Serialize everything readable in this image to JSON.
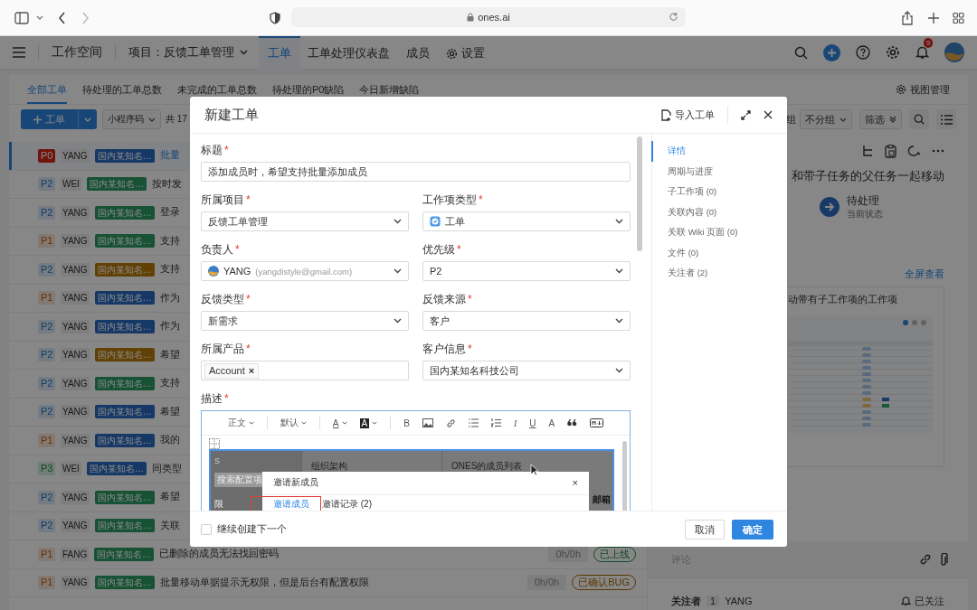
{
  "browser": {
    "url": "ones.ai"
  },
  "header": {
    "workspace": "工作空间",
    "project": "项目：反馈工单管理",
    "nav": [
      {
        "label": "工单",
        "kind": "plain",
        "selected": true
      },
      {
        "label": "工单处理仪表盘",
        "kind": "plain",
        "selected": false
      },
      {
        "label": "成员",
        "kind": "plain",
        "selected": false
      },
      {
        "label": "设置",
        "kind": "settings",
        "selected": false
      }
    ],
    "notification_count": "9"
  },
  "view_tabs": [
    {
      "label": "全部工单",
      "selected": true
    },
    {
      "label": "待处理的工单总数",
      "selected": false
    },
    {
      "label": "未完成的工单总数",
      "selected": false
    },
    {
      "label": "待处理的P0缺陷",
      "selected": false
    },
    {
      "label": "今日新增缺陷",
      "selected": false
    }
  ],
  "view_manage": "视图管理",
  "toolbar": {
    "new_button": "工单",
    "sort": "小程序码",
    "count": "共 17",
    "group_label": "组",
    "group": "不分组",
    "filter": "筛选"
  },
  "rows": [
    {
      "priority": {
        "label": "P0",
        "color": "#70150f",
        "filled": true
      },
      "assignee": "YANG",
      "customer": {
        "label": "国内某知名…",
        "color": "#163866"
      },
      "title": "批量",
      "selected": true
    },
    {
      "priority": {
        "label": "P2",
        "color": "#747b82",
        "filled": false
      },
      "assignee": "WEI",
      "customer": {
        "label": "国内某知名…",
        "color": "#185234"
      },
      "title": "按时发",
      "selected": false
    },
    {
      "priority": {
        "label": "P2",
        "color": "#747b82",
        "filled": false
      },
      "assignee": "YANG",
      "customer": {
        "label": "国内某知名…",
        "color": "#185234"
      },
      "title": "登录",
      "selected": false
    },
    {
      "priority": {
        "label": "P1",
        "color": "#827972",
        "filled": false
      },
      "assignee": "YANG",
      "customer": {
        "label": "国内某知名…",
        "color": "#185234"
      },
      "title": "支持",
      "selected": false
    },
    {
      "priority": {
        "label": "P2",
        "color": "#747b82",
        "filled": false
      },
      "assignee": "YANG",
      "customer": {
        "label": "国内某知名…",
        "color": "#624105"
      },
      "title": "支持",
      "selected": false
    },
    {
      "priority": {
        "label": "P1",
        "color": "#827972",
        "filled": false
      },
      "assignee": "YANG",
      "customer": {
        "label": "国内某知名…",
        "color": "#163866"
      },
      "title": "作为",
      "selected": false
    },
    {
      "priority": {
        "label": "P2",
        "color": "#747b82",
        "filled": false
      },
      "assignee": "YANG",
      "customer": {
        "label": "国内某知名…",
        "color": "#163866"
      },
      "title": "作为",
      "selected": false
    },
    {
      "priority": {
        "label": "P2",
        "color": "#747b82",
        "filled": false
      },
      "assignee": "YANG",
      "customer": {
        "label": "国内某知名…",
        "color": "#624105"
      },
      "title": "希望",
      "selected": false
    },
    {
      "priority": {
        "label": "P2",
        "color": "#747b82",
        "filled": false
      },
      "assignee": "YANG",
      "customer": {
        "label": "国内某知名…",
        "color": "#185234"
      },
      "title": "支持",
      "selected": false
    },
    {
      "priority": {
        "label": "P2",
        "color": "#747b82",
        "filled": false
      },
      "assignee": "YANG",
      "customer": {
        "label": "国内某知名…",
        "color": "#163866"
      },
      "title": "希望",
      "selected": false
    },
    {
      "priority": {
        "label": "P1",
        "color": "#827972",
        "filled": false
      },
      "assignee": "YANG",
      "customer": {
        "label": "国内某知名…",
        "color": "#163866"
      },
      "title": "我的",
      "selected": false
    },
    {
      "priority": {
        "label": "P3",
        "color": "#737d77",
        "filled": false
      },
      "assignee": "WEI",
      "customer": {
        "label": "国内某知名…",
        "color": "#163866"
      },
      "title": "同类型",
      "selected": false
    },
    {
      "priority": {
        "label": "P2",
        "color": "#747b82",
        "filled": false
      },
      "assignee": "YANG",
      "customer": {
        "label": "国内某知名…",
        "color": "#185234"
      },
      "title": "希望",
      "selected": false
    },
    {
      "priority": {
        "label": "P2",
        "color": "#747b82",
        "filled": false
      },
      "assignee": "YANG",
      "customer": {
        "label": "国内某知名…",
        "color": "#185234"
      },
      "title": "关联",
      "selected": false
    },
    {
      "priority": {
        "label": "P1",
        "color": "#827972",
        "filled": false
      },
      "assignee": "FANG",
      "customer": {
        "label": "国内某知名…",
        "color": "#185234"
      },
      "title": "已删除的成员无法找回密码",
      "selected": false,
      "hours": "0h/0h",
      "status": {
        "label": "已上线",
        "color": "#10492a"
      }
    },
    {
      "priority": {
        "label": "P1",
        "color": "#827972",
        "filled": false
      },
      "assignee": "YANG",
      "customer": {
        "label": "国内某知名…",
        "color": "#185234"
      },
      "title": "批量移动单据提示无权限，但是后台有配置权限",
      "selected": false,
      "hours": "0h/0h",
      "status": {
        "label": "已确认BUG",
        "color": "#593800"
      }
    }
  ],
  "detail": {
    "heading": "和带子任务的父任务一起移动",
    "status": "待处理",
    "status_caption": "当前状态",
    "fullscreen_link": "全屏查看",
    "card_title": "动带有子工作项的工作项",
    "comment_placeholder": "评论",
    "followers_label": "关注者",
    "followers_count": "1",
    "follower": "YANG",
    "follow_state": "已关注"
  },
  "modal": {
    "title": "新建工单",
    "import_button": "导入工单",
    "fields": [
      {
        "label": "标题",
        "required_mark": "*",
        "kind": "text",
        "wide": true,
        "value": "添加成员时，希望支持批量添加成员"
      },
      {
        "label": "所属项目",
        "required_mark": "*",
        "kind": "select",
        "wide": false,
        "value": "反馈工单管理"
      },
      {
        "label": "工作项类型",
        "required_mark": "*",
        "kind": "type",
        "wide": false,
        "value": "工单"
      },
      {
        "label": "负责人",
        "required_mark": "*",
        "kind": "user",
        "wide": false,
        "value": "YANG",
        "email": "(yangdistyle@gmail.com)"
      },
      {
        "label": "优先级",
        "required_mark": "*",
        "kind": "select",
        "wide": false,
        "value": "P2"
      },
      {
        "label": "反馈类型",
        "required_mark": "*",
        "kind": "select",
        "wide": false,
        "value": "新需求"
      },
      {
        "label": "反馈来源",
        "required_mark": "*",
        "kind": "select",
        "wide": false,
        "value": "客户"
      },
      {
        "label": "所属产品",
        "required_mark": "*",
        "kind": "tags",
        "wide": false,
        "tags": [
          "Account"
        ],
        "remove": "×"
      },
      {
        "label": "客户信息",
        "required_mark": "*",
        "kind": "select",
        "wide": false,
        "value": "国内某知名科技公司"
      }
    ],
    "description": {
      "label": "描述",
      "required_mark": "*",
      "toolbar": [
        {
          "kind": "select",
          "label": "正文"
        },
        {
          "kind": "select",
          "label": "默认"
        },
        {
          "kind": "color",
          "label": "A"
        },
        {
          "kind": "highlight",
          "label": "A"
        },
        {
          "kind": "glyph",
          "label": "B"
        },
        {
          "kind": "image"
        },
        {
          "kind": "link"
        },
        {
          "kind": "bullets"
        },
        {
          "kind": "numbers"
        },
        {
          "kind": "italic",
          "label": "I"
        },
        {
          "kind": "underline",
          "label": "U"
        },
        {
          "kind": "glyph",
          "label": "A"
        },
        {
          "kind": "quote"
        },
        {
          "kind": "markdown"
        }
      ],
      "screenshot": {
        "sidebar_letter": "S",
        "search_placeholder": "搜索配置项",
        "sidebar_item": "限",
        "column_1": "组织架构",
        "column_2": "ONES的成员列表",
        "column_3": "邮箱",
        "dialog_title": "邀请新成员",
        "dialog_close": "×",
        "dialog_tabs": [
          {
            "label": "邀请成员",
            "selected": true
          },
          {
            "label": "邀请记录 (2)",
            "selected": false
          }
        ]
      }
    },
    "nav": [
      {
        "label": "详情",
        "selected": true
      },
      {
        "label": "周期与进度",
        "selected": false
      },
      {
        "label": "子工作项 (0)",
        "selected": false
      },
      {
        "label": "关联内容 (0)",
        "selected": false
      },
      {
        "label": "关联 Wiki 页面 (0)",
        "selected": false
      },
      {
        "label": "文件 (0)",
        "selected": false
      },
      {
        "label": "关注者 (2)",
        "selected": false
      }
    ],
    "continue_checkbox": {
      "label": "继续创建下一个",
      "checked": false
    },
    "cancel_button": "取消",
    "confirm_button": "确定"
  }
}
